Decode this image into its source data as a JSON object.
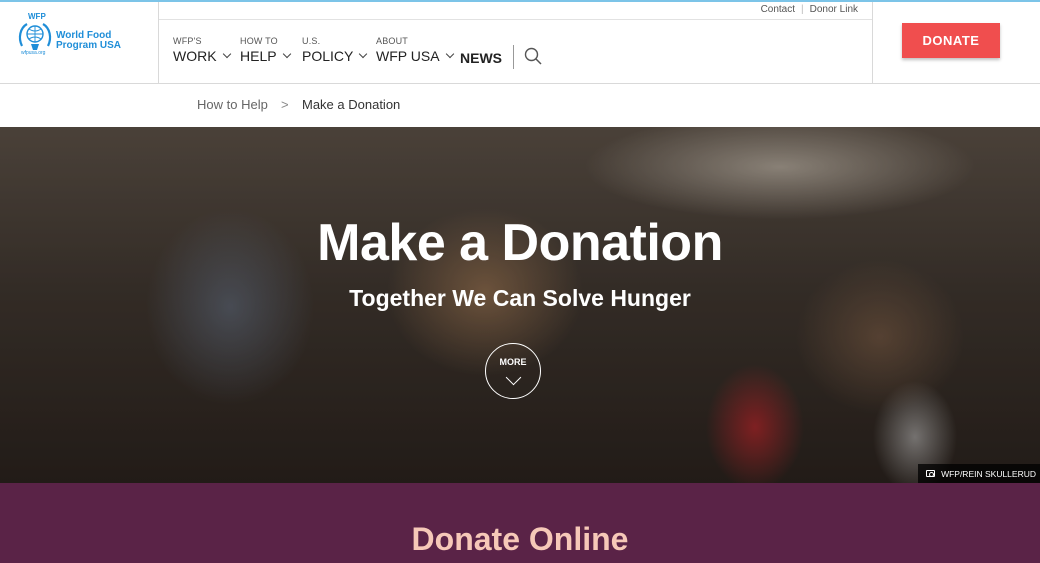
{
  "logo": {
    "abbr": "WFP",
    "name": "World Food Program USA",
    "url": "wfpusa.org"
  },
  "utility": {
    "contact": "Contact",
    "donor_link": "Donor Link",
    "separator": "|"
  },
  "nav": {
    "items": [
      {
        "small": "WFP'S",
        "big": "WORK"
      },
      {
        "small": "HOW TO",
        "big": "HELP"
      },
      {
        "small": "U.S.",
        "big": "POLICY"
      },
      {
        "small": "ABOUT",
        "big": "WFP USA"
      }
    ],
    "news": "NEWS",
    "search_icon": "search-icon"
  },
  "header": {
    "donate_label": "DONATE"
  },
  "breadcrumb": {
    "parent": "How to Help",
    "separator": ">",
    "current": "Make a Donation"
  },
  "hero": {
    "title": "Make a Donation",
    "subtitle": "Together We Can Solve Hunger",
    "more_label": "MORE",
    "photo_credit": "WFP/REIN SKULLERUD"
  },
  "section": {
    "donate_online_title": "Donate Online"
  },
  "colors": {
    "brand_blue": "#1f8ed8",
    "donate_red": "#f04e4e",
    "section_purple": "#5a2347",
    "section_title": "#f6c8b8"
  }
}
